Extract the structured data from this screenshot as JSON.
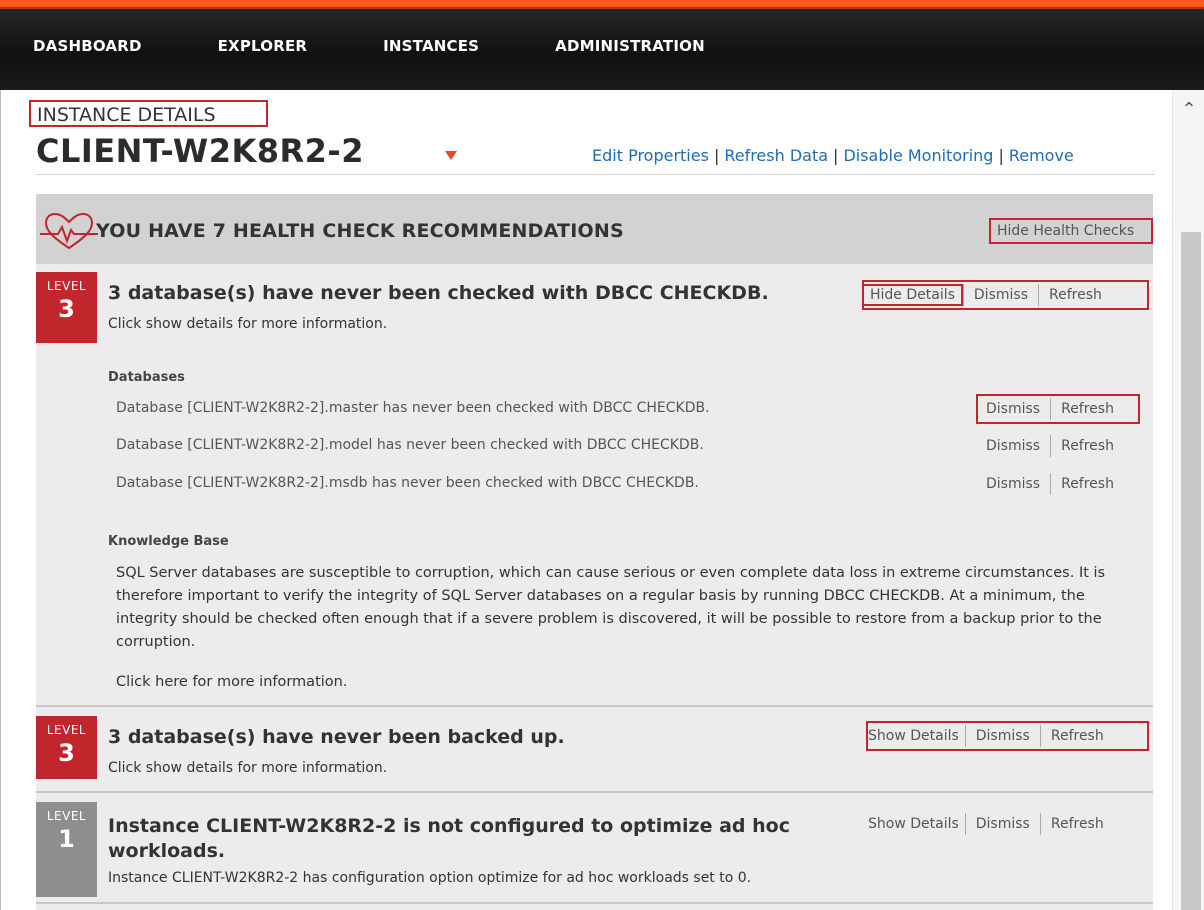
{
  "nav": {
    "items": [
      "DASHBOARD",
      "EXPLORER",
      "INSTANCES",
      "ADMINISTRATION"
    ]
  },
  "header": {
    "label": "INSTANCE DETAILS",
    "instance_name": "CLIENT-W2K8R2-2",
    "actions": [
      "Edit Properties",
      "Refresh Data",
      "Disable Monitoring",
      "Remove"
    ],
    "separator": "|"
  },
  "health": {
    "title": "YOU HAVE 7 HEALTH CHECK RECOMMENDATIONS",
    "hide_label": "Hide Health Checks",
    "level_word": "LEVEL",
    "recommendations": [
      {
        "level": "3",
        "title": "3 database(s) have never been checked with DBCC CHECKDB.",
        "subtitle": "Click show details for more information.",
        "buttons": [
          "Hide Details",
          "Dismiss",
          "Refresh"
        ],
        "details": {
          "databases_label": "Databases",
          "databases": [
            {
              "text": "Database [CLIENT-W2K8R2-2].master has never been checked with DBCC CHECKDB.",
              "buttons": [
                "Dismiss",
                "Refresh"
              ]
            },
            {
              "text": "Database [CLIENT-W2K8R2-2].model has never been checked with DBCC CHECKDB.",
              "buttons": [
                "Dismiss",
                "Refresh"
              ]
            },
            {
              "text": "Database [CLIENT-W2K8R2-2].msdb has never been checked with DBCC CHECKDB.",
              "buttons": [
                "Dismiss",
                "Refresh"
              ]
            }
          ],
          "kb_label": "Knowledge Base",
          "kb_text": "SQL Server databases are susceptible to corruption, which can cause serious or even complete data loss in extreme circumstances. It is therefore important to verify the integrity of SQL Server databases on a regular basis by running DBCC CHECKDB. At a minimum, the integrity should be checked often enough that if a severe problem is discovered, it will be possible to restore from a backup prior to the corruption.",
          "kb_link": "Click here for more information."
        }
      },
      {
        "level": "3",
        "title": "3 database(s) have never been backed up.",
        "subtitle": "Click show details for more information.",
        "buttons": [
          "Show Details",
          "Dismiss",
          "Refresh"
        ]
      },
      {
        "level": "1",
        "title": "Instance CLIENT-W2K8R2-2 is not configured to optimize ad hoc workloads.",
        "subtitle": "Instance CLIENT-W2K8R2-2 has configuration option optimize for ad hoc workloads set to 0.",
        "buttons": [
          "Show Details",
          "Dismiss",
          "Refresh"
        ]
      }
    ]
  },
  "colors": {
    "accent_orange": "#ff5a1f",
    "level3_red": "#c0262c",
    "level1_grey": "#8e8e8e",
    "link_blue": "#1f6bb5",
    "highlight_red": "#c0262c"
  }
}
